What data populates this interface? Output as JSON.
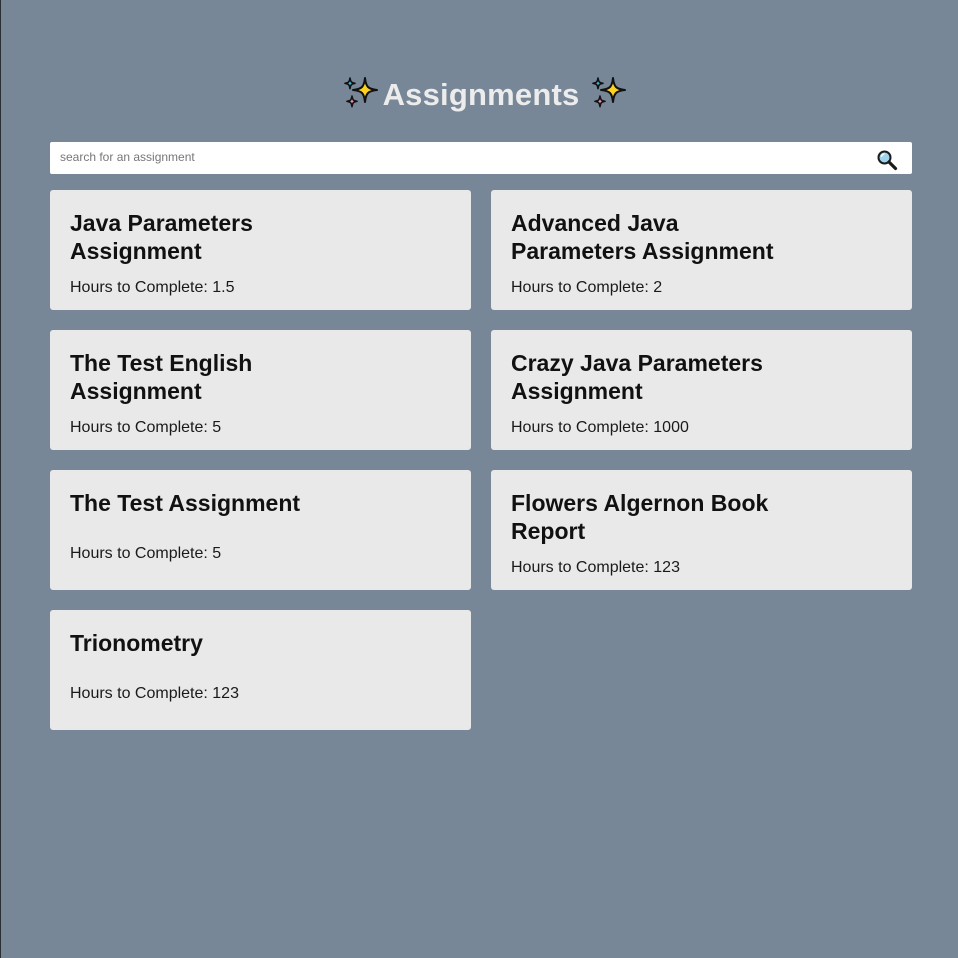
{
  "header": {
    "title": "Assignments",
    "left_icon": "sparkles-icon",
    "right_icon": "sparkles-icon"
  },
  "search": {
    "placeholder": "search for an assignment",
    "value": "",
    "button_icon": "magnifying-glass-icon"
  },
  "colors": {
    "background": "#778797",
    "card": "#e9e9e9",
    "title_text": "#ececec",
    "sparkle_yellow": "#ffd21f",
    "sparkle_blue": "#37b6e6",
    "sparkle_pink": "#f08bb8"
  },
  "assignments": [
    {
      "title": "Java Parameters\nAssignment",
      "hours_label": "Hours to Complete: 1.5"
    },
    {
      "title": "Advanced Java\nParameters Assignment",
      "hours_label": "Hours to Complete: 2"
    },
    {
      "title": "The Test English\nAssignment",
      "hours_label": "Hours to Complete: 5"
    },
    {
      "title": "Crazy Java Parameters\nAssignment",
      "hours_label": "Hours to Complete: 1000"
    },
    {
      "title": "The Test Assignment",
      "hours_label": "Hours to Complete: 5"
    },
    {
      "title": "Flowers Algernon Book\nReport",
      "hours_label": "Hours to Complete: 123"
    },
    {
      "title": "Trionometry",
      "hours_label": "Hours to Complete: 123"
    }
  ]
}
